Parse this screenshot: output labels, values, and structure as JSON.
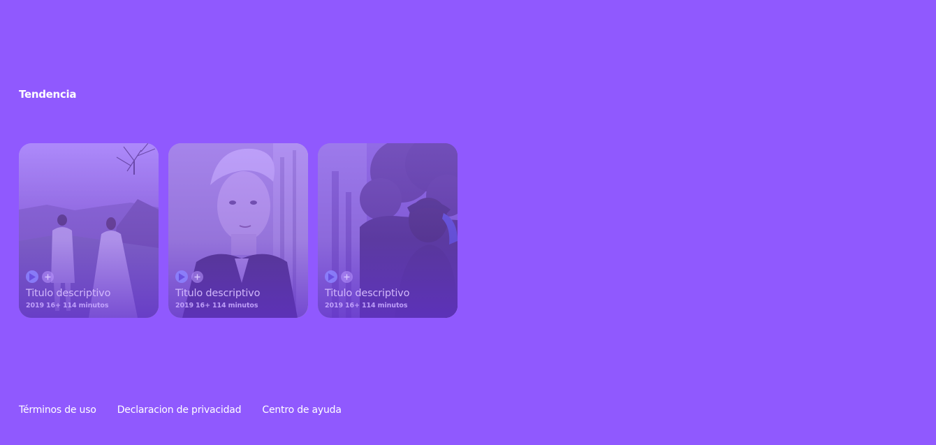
{
  "trending": {
    "title": "Tendencia",
    "cards": [
      {
        "title": "Titulo descriptivo",
        "year": "2019",
        "rating": "16+",
        "duration": "114 minutos",
        "image": "couple-in-field-photo"
      },
      {
        "title": "Titulo descriptivo",
        "year": "2019",
        "rating": "16+",
        "duration": "114 minutos",
        "image": "blond-young-man-portrait"
      },
      {
        "title": "Titulo descriptivo",
        "year": "2019",
        "rating": "16+",
        "duration": "114 minutos",
        "image": "man-under-tree-portrait"
      }
    ]
  },
  "footer": {
    "links": [
      "Términos de uso",
      "Declaracion de privacidad",
      "Centro de ayuda"
    ]
  },
  "colors": {
    "background": "#9059fe",
    "text": "#ffffff",
    "play_button": "#8c82ff"
  },
  "icons": {
    "play": "play-icon",
    "add": "plus-icon"
  }
}
